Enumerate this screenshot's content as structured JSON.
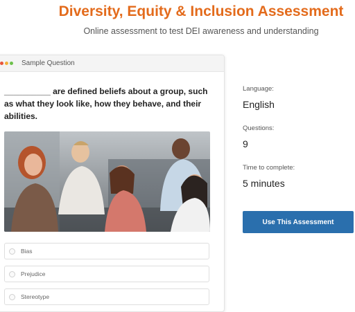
{
  "header": {
    "title": "Diversity, Equity & Inclusion Assessment",
    "subtitle": "Online assessment to test DEI awareness and understanding"
  },
  "sample": {
    "label": "Sample Question",
    "dot_colors": [
      "#e8553a",
      "#f3b13b",
      "#6cc04a"
    ],
    "question": "__________ are defined beliefs about a group, such as what they look like, how they behave, and their abilities.",
    "options": [
      "Bias",
      "Prejudice",
      "Stereotype"
    ]
  },
  "details": {
    "language_label": "Language:",
    "language_value": "English",
    "questions_label": "Questions:",
    "questions_value": "9",
    "time_label": "Time to complete:",
    "time_value": "5 minutes"
  },
  "cta": {
    "label": "Use This Assessment",
    "color": "#2a6fad"
  },
  "colors": {
    "title": "#e36b1c"
  }
}
